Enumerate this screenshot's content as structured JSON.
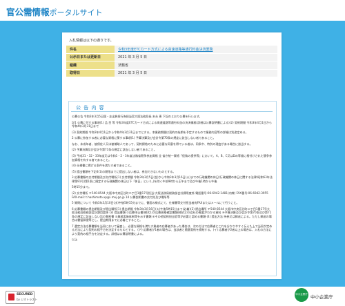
{
  "header": {
    "title_main": "官公需情報",
    "title_sub": "ポータルサイト"
  },
  "intro": "入札情報は以下の通りです。",
  "info_rows": [
    {
      "label": "件名",
      "value": "令和3年度ETCカード方式による高速道路等通行料金決済業務",
      "link": true
    },
    {
      "label": "公示日または更新日",
      "value": "2021 年 3 月 5 日",
      "link": false
    },
    {
      "label": "組織",
      "value": "法務省",
      "link": false
    },
    {
      "label": "取得日",
      "value": "2021 年 3 月 5 日",
      "link": false
    }
  ],
  "notice": {
    "heading": "公 告 内 容",
    "paragraphs": [
      "公募公告 令和3年3月5日国・支出負担行為担当官大阪法務局長 末永 恵 下記のとおり公募を行います。",
      "記1 公募に付する事項(1) 品 目 等 令和3年度ETCカード方式による高速道路等通行料金の決済業務(詳細は公募説明書による)(2) 契約期間 令和3年4月1日から令和4年3月31日まで",
      "(3) 契約期間 令和3年4月1日から令和4年3月31日までとする。本業務期間は契約の始期を予定するもので業務内容等の詳細は別途定める。",
      "2 公募に参加する者に必要な資格に関する事項(1) 予算決算及び会計令第70条の規定に該当しない者であること。",
      "なお、未成年者、被保佐人又は被補助人であって、契約締結のために必要な同意を得ている者は、同条中、特別の理由がある場合に該当する。",
      "(2) 予算決算及び会計令第71条の規定に該当しない者であること。",
      "(3) 平成31・32・33年度又は令和1・2・3年度法務省競争参加資格 全 省庁統一資格「役務の提供等」において、A、B、C又はDの等級に格付けされた競争参加資格を有する者であること。",
      "(4) 仕様書に掲げる条件を満たす者であること。",
      "(5) 提出書類を下記4(1)の期限までに提出しない者は、参加できないものとする。",
      "3 応募書類の交付期間及び交付場所(1) 交付期間 令和3年3月5日(金)から令和3年3月16日(火)までの行政機関の休日(行政機関の休日に関する法律(昭和63年法律第91号)第1条に規定する行政機関の休日以下「休日」という。)を除く午前9時から正午まで及び午後1時から午後",
      "5時15分まで。",
      "(2) 交付場所 〒540-8544 大阪市中央区谷町二丁目1番17号担当:大阪法務局総務部会計課用度係 電話番号:06-6942-1481(内線) FAX番号:06-6942-3955 FAX-mail: t.hashimoto.xp@i.moj.go.jp 14 公募説明書の交付先及び場所等",
      "5 質問について 令和3年3月10日(水)午後5時15分までに、書面の様式にて、仕様書等交付担当者宛FAXまたはメールにて行うこと。",
      "6 応募書類の提出期限及び提出場所(1) 提出期限 令和3年3月16日(火)午後5時15分まで(必着)(2) 提出場所 〒540-8544 大阪市中央区谷町二丁目1番17号大阪法務局総務部会計課用度係 (3) 提出書類 ①応募申込書(様式1)②応募資格確認書類(様式2)③会社の概要がわかる資料 ④予算決算及び会計令第70条及び第71条の規定に該当しない旨の誓約書 ⑤業務実施体制等を示す書類 ⑥その他契約担当官等が必要と認める書類 (4) 提出方法 持参又は郵送による。ただし郵送の場合は書留郵便等とし、提出期限までに必着とすること。",
      "7 選定方法応募書類を当局において審査し、必要な資格を満たす業者の応募者があった場合は、次の方法で応募者にこれを分かりやすく伝えた上で当局が定める方法により契約の相手方を決定するものとする。 (ア) 応募者が1者の場合は、当該者と随意契約を締結する。(イ) 応募者が2者以上の場合は、入札の方法により契約の相手方を決定する。詳細は公募説明書による。",
      "以上"
    ]
  },
  "footer": {
    "secured_title": "SECURED",
    "secured_sub": "by ジオトラスト",
    "mascot_text": "中小企業庁",
    "org_name": "中小企業庁"
  },
  "colors": {
    "brand": "#1d84c6",
    "background": "#3fb1e6",
    "label_bg": "#ede08a"
  }
}
